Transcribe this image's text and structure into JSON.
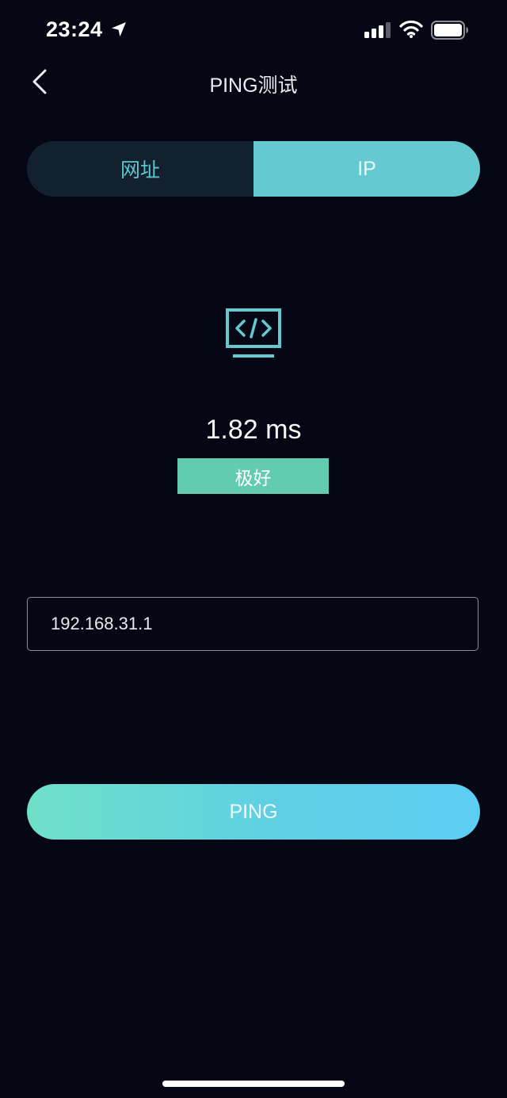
{
  "status_bar": {
    "time": "23:24",
    "icons": [
      "location-arrow-icon",
      "cellular-signal-icon",
      "wifi-icon",
      "battery-icon"
    ]
  },
  "nav": {
    "title": "PING测试",
    "back_icon": "chevron-left-icon"
  },
  "tabs": [
    {
      "label": "网址",
      "selected": false
    },
    {
      "label": "IP",
      "selected": true
    }
  ],
  "result": {
    "icon": "code-monitor-icon",
    "latency": "1.82 ms",
    "quality": "极好"
  },
  "input": {
    "value": "192.168.31.1"
  },
  "action": {
    "label": "PING"
  },
  "colors": {
    "background": "#050814",
    "accent": "#65c9d1",
    "badge": "#62cbb0",
    "gradient_start": "#6fe0c7",
    "gradient_end": "#5ecdf3"
  }
}
